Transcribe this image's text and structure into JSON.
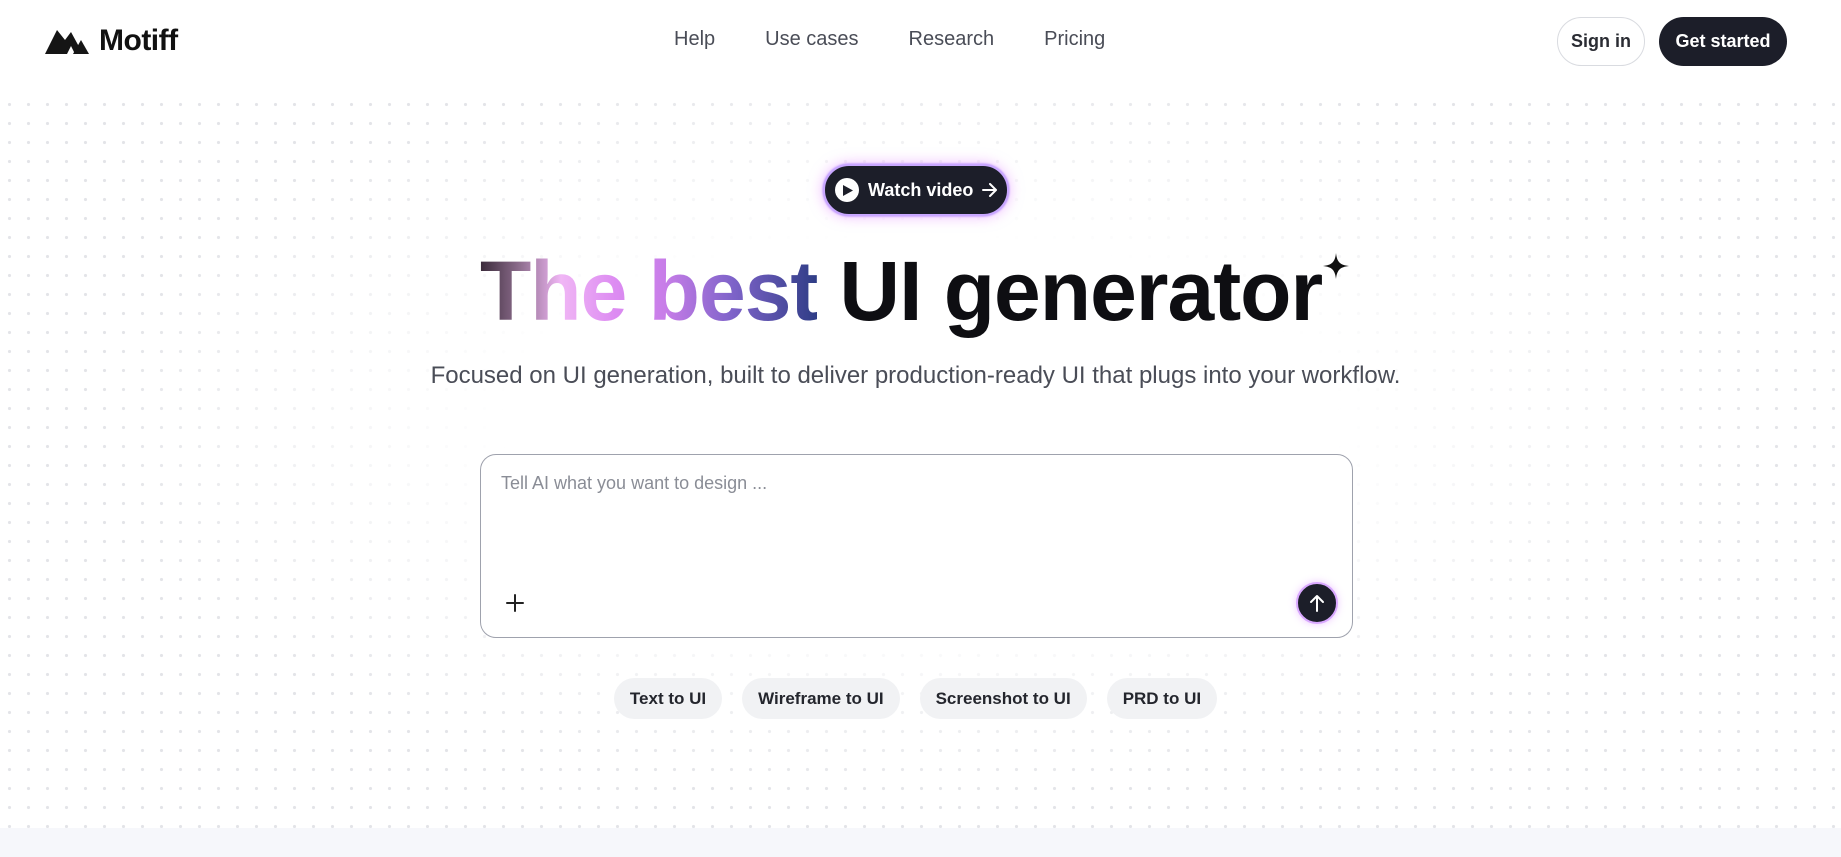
{
  "header": {
    "brand": "Motiff",
    "nav": [
      "Help",
      "Use cases",
      "Research",
      "Pricing"
    ],
    "sign_in": "Sign in",
    "get_started": "Get started"
  },
  "hero": {
    "watch_video": "Watch video",
    "title_gradient": "The best",
    "title_dark": "UI generator",
    "subtitle": "Focused on UI generation, built to deliver production-ready UI that plugs into your workflow."
  },
  "prompt": {
    "placeholder": "Tell AI what you want to design ..."
  },
  "chips": [
    "Text to UI",
    "Wireframe to UI",
    "Screenshot to UI",
    "PRD to UI"
  ],
  "colors": {
    "primary_dark": "#1c1e29",
    "accent_pink": "#dd8cf2",
    "accent_purple": "#7e63c9",
    "accent_navy": "#2f3d86"
  }
}
